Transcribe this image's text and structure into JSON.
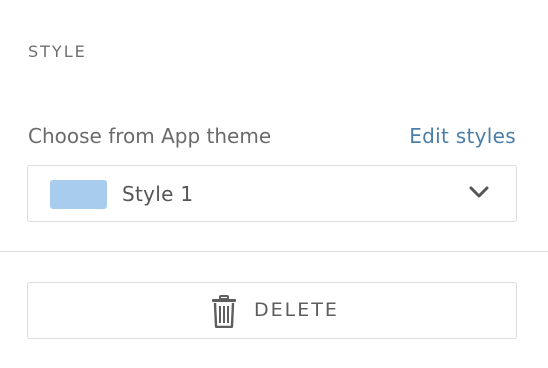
{
  "section": {
    "title": "STYLE"
  },
  "theme_row": {
    "label": "Choose from App theme",
    "edit_link": "Edit styles"
  },
  "style_select": {
    "value": "Style 1",
    "swatch_color": "#a8ccee",
    "icon": "chevron-down-icon"
  },
  "delete": {
    "label": "DELETE",
    "icon": "trash-icon"
  },
  "colors": {
    "link": "#4b7ea8",
    "text": "#6b6b6b",
    "border": "#dcdcdc"
  }
}
